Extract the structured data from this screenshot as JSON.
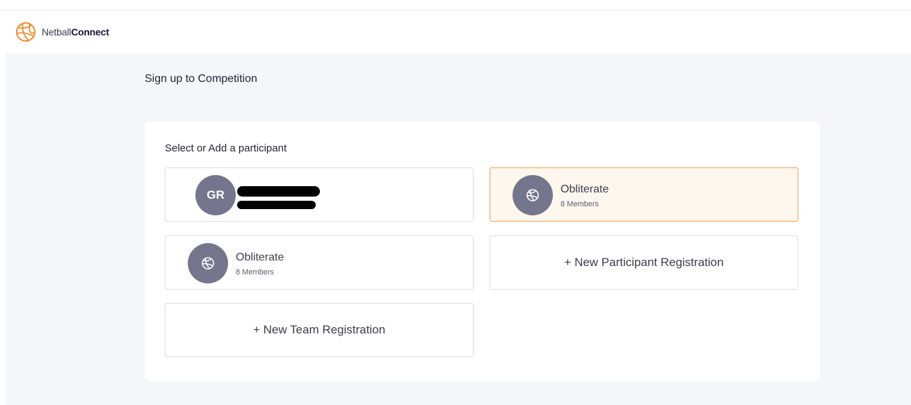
{
  "header": {
    "brand_light": "Netball",
    "brand_bold": "Connect",
    "logo_icon": "netball-icon",
    "logo_color": "#f28b2b"
  },
  "page": {
    "title": "Sign up to Competition"
  },
  "panel": {
    "heading": "Select or Add a participant"
  },
  "cards": {
    "participant": {
      "initials": "GR",
      "name_redacted": true,
      "details_redacted": true
    },
    "team_selected": {
      "icon": "netball-icon",
      "name": "Obliterate",
      "members": "8 Members",
      "highlight_color": "#f5a14e"
    },
    "team_two": {
      "icon": "netball-icon",
      "name": "Obliterate",
      "members": "8 Members"
    },
    "new_participant": {
      "label": "+ New Participant Registration"
    },
    "new_team": {
      "label": "+ New Team Registration"
    }
  }
}
